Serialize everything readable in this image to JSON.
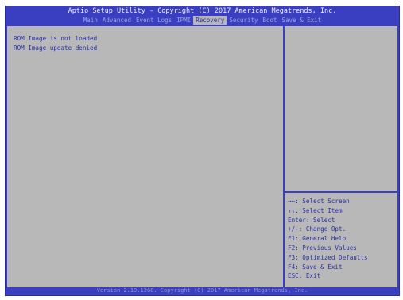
{
  "title": "Aptio Setup Utility - Copyright (C) 2017 American Megatrends, Inc.",
  "menu": {
    "tabs": [
      {
        "label": "Main"
      },
      {
        "label": "Advanced"
      },
      {
        "label": "Event Logs"
      },
      {
        "label": "IPMI"
      },
      {
        "label": "Recovery",
        "active": true
      },
      {
        "label": "Security"
      },
      {
        "label": "Boot"
      },
      {
        "label": "Save & Exit"
      }
    ]
  },
  "main": {
    "messages": [
      "ROM Image is not loaded",
      "ROM Image update denied"
    ]
  },
  "help": {
    "keys": [
      "→←: Select Screen",
      "↑↓: Select Item",
      "Enter: Select",
      "+/-: Change Opt.",
      "F1: General Help",
      "F2: Previous Values",
      "F3: Optimized Defaults",
      "F4: Save & Exit",
      "ESC: Exit"
    ]
  },
  "footer": "Version 2.19.1268. Copyright (C) 2017 American Megatrends, Inc.",
  "colors": {
    "frame": "#3a3ec0",
    "panel": "#b8b8b8",
    "text": "#2830a8",
    "title_text": "#f0f0f0"
  }
}
